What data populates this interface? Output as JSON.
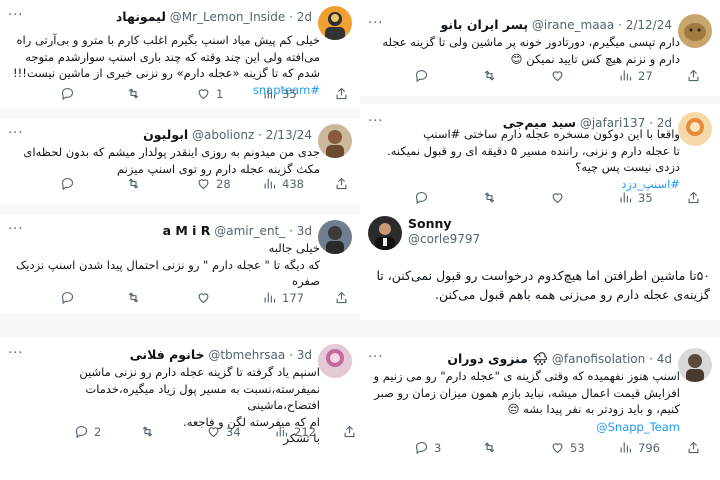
{
  "tweets": [
    {
      "name": "لیمونهاد",
      "handle": "@Mr_Lemon_Inside",
      "time": "2d",
      "lines": [
        "خیلی کم پیش میاد اسنپ بگیرم اغلب کارم با مترو و بی‌آرتی راه",
        "می‌افته ولی این چند وقته که چند باری اسنپ سوارشدم متوجه",
        "شدم که تا گزینه «عجله دارم» رو نزنی خیری از ماشین نیست!!!"
      ],
      "hashtag": "#snapteam",
      "replies": "",
      "retweets": "",
      "likes": "1",
      "views": "35"
    },
    {
      "name": "ابولیون",
      "handle": "@abolionz",
      "time": "2/13/24",
      "lines": [
        "جدی من میدونم به روزی اینقدر پولدار میشم که بدون لحظه‌ای",
        "مکث گزینه عجله دارم رو توی اسنپ میزنم"
      ],
      "replies": "",
      "retweets": "",
      "likes": "28",
      "views": "438"
    },
    {
      "name": "a M i R",
      "handle": "@amir_ent_",
      "time": "3d",
      "lines": [
        "خیلی جالبه",
        "که دیگه تا \" عجله دارم \" رو نزنی احتمال پیدا شدن اسنپ نزدیک",
        "صفره"
      ],
      "replies": "",
      "retweets": "",
      "likes": "",
      "views": "177"
    },
    {
      "name": "خانوم فلانی",
      "handle": "@tbmehrsaa",
      "time": "3d",
      "lines": [
        "اسنپم یاد گرفته تا گزینه عجله دارم رو نزنی ماشین",
        "نمیفرسته،نسبت به مسیر پول زیاد میگیره،خدمات افتضاح،ماشینی",
        "ام که میفرسته لگن و فاجعه.",
        "با تشکر"
      ],
      "replies": "2",
      "retweets": "",
      "likes": "34",
      "views": "212"
    },
    {
      "name": "پسر ایران بانو",
      "handle": "@irane_maaa",
      "time": "2/12/24",
      "lines": [
        "دارم تپسی میگیرم، دورتادور خونه پر ماشین ولی تا گزینه عجله",
        "دارم و نزنم هیچ کس تایید نمیکن 😊"
      ],
      "replies": "",
      "retweets": "",
      "likes": "",
      "views": "27"
    },
    {
      "name": "سید میم‌جی",
      "handle": "@jafari137",
      "time": "2d",
      "lines": [
        "واقعا با این دوکون مسخره عجله دارم ساختی #اسنپ",
        "تا عجله دارم و نزنی، راننده مسیر ۵ دقیقه ای رو قبول نمیکنه.",
        "دزدی نیست پس چیه؟"
      ],
      "hashtag": "#اسنپ_دزد",
      "replies": "",
      "retweets": "",
      "likes": "",
      "views": "35"
    },
    {
      "name": "Sonny",
      "handle": "@corle9797",
      "time": "",
      "lines": [
        "۵۰تا ماشین اطرافتن اما هیچ‌کدوم درخواست رو قبول نمی‌کنن، تا",
        "گزینه‌ی عجله دارم رو می‌زنی همه باهم قبول می‌کنن."
      ],
      "replies": "",
      "retweets": "",
      "likes": "",
      "views": ""
    },
    {
      "name": "منزوی دوران 🌧",
      "handle": "@fanofisolation",
      "time": "4d",
      "lines": [
        "اسنپ هنوز نفهمیده که وقتی گزینه ی \"عجله دارم\" رو می زنیم و",
        "افزایش قیمت اعمال میشه، نباید بازم همون میزان زمان رو صبر",
        "کنیم، و باید زودتر به نفر پیدا بشه 😔"
      ],
      "mention": "@Snapp_Team",
      "replies": "3",
      "retweets": "",
      "likes": "53",
      "views": "796"
    }
  ],
  "colors": {
    "accent": "#1d9bf0",
    "muted": "#536471",
    "text": "#0f1419"
  }
}
